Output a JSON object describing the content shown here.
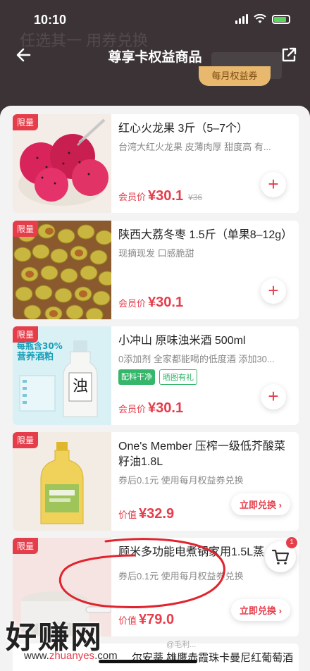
{
  "status_bar": {
    "time": "10:10"
  },
  "ghost_banner": {
    "text": "任选其一 用券兑换"
  },
  "nav": {
    "title": "尊享卡权益商品"
  },
  "badge": {
    "label": "每月权益券"
  },
  "products": [
    {
      "tag": "限量",
      "name": "红心火龙果 3斤（5–7个）",
      "desc": "台湾大红火龙果 皮薄肉厚 甜度高 有...",
      "price_label": "会员价",
      "price": "¥30.1",
      "old_price": "¥36",
      "image": "dragon-fruit"
    },
    {
      "tag": "限量",
      "name": "陕西大荔冬枣 1.5斤（单果8–12g）",
      "desc": "现摘现发 口感脆甜",
      "price_label": "会员价",
      "price": "¥30.1",
      "image": "winter-jujube"
    },
    {
      "tag": "限量",
      "name": "小冲山 原味浊米酒 500ml",
      "desc": "0添加剂 全家都能喝的低度酒 添加30...",
      "chips": [
        "配料干净",
        "晒图有礼"
      ],
      "image_text": {
        "line1": "每瓶含30%",
        "line2": "营养酒粕"
      },
      "price_label": "会员价",
      "price": "¥30.1",
      "image": "rice-wine"
    },
    {
      "tag": "限量",
      "name": "One's Member 压榨一级低芥酸菜籽油1.8L",
      "desc": "券后0.1元 使用每月权益券兑换",
      "price_label": "价值",
      "price": "¥32.9",
      "action": "立即兑换 ›",
      "image": "rapeseed-oil"
    },
    {
      "tag": "限量",
      "name": "顾米多功能电煮锅家用1.5L蒸",
      "desc": "券后0.1元 使用每月权益券兑换",
      "price_label": "价值",
      "price": "¥79.0",
      "action": "立即兑换 ›",
      "image": "electric-pot"
    }
  ],
  "last_card": {
    "title": "…尔安蒂 雄鹰赤霞珠卡曼尼红葡萄酒"
  },
  "cart": {
    "badge_count": "1"
  },
  "watermark": {
    "big": "好赚网",
    "url_prefix": "www.",
    "url_brand": "zhuanyes",
    "url_suffix": ".com"
  },
  "weibo": {
    "text": "@毛利..."
  },
  "colors": {
    "accent": "#e63d4a",
    "gold": "#e8b86e",
    "green": "#35b66b",
    "dark_bg": "#3b3336"
  }
}
